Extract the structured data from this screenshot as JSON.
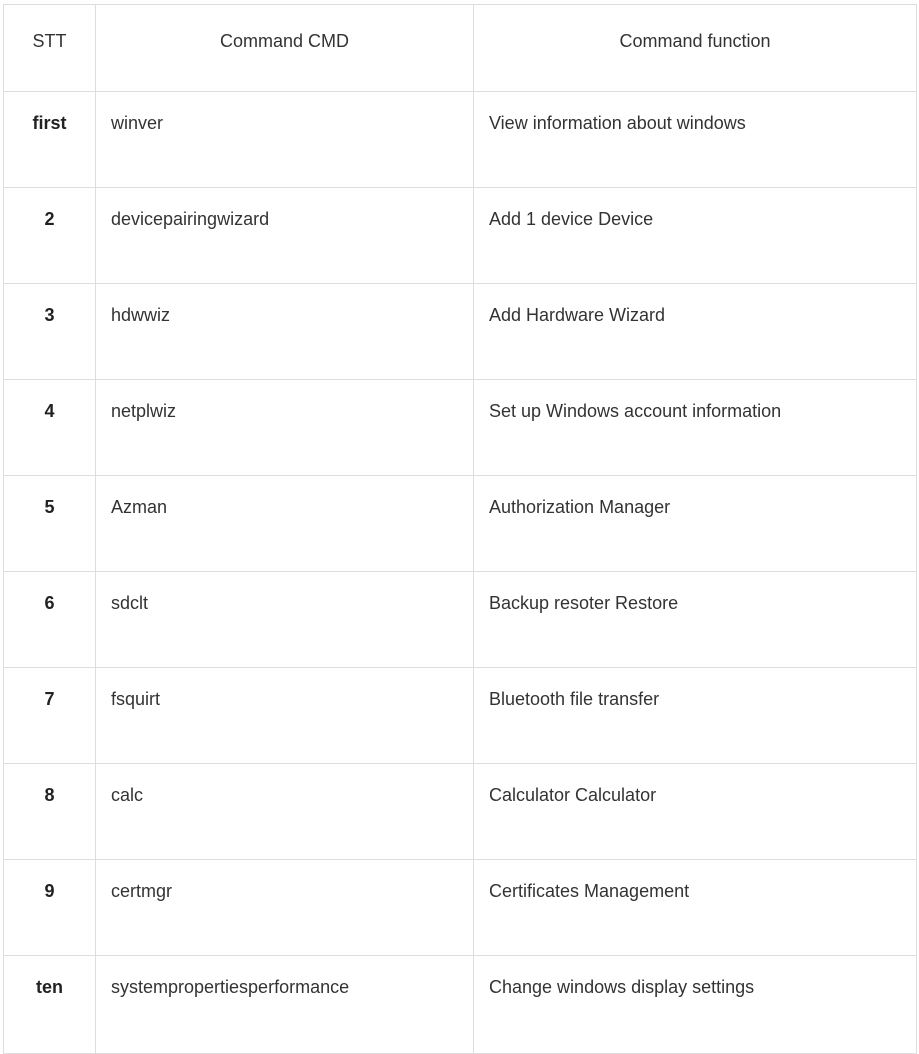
{
  "table": {
    "headers": [
      "STT",
      "Command CMD",
      "Command function"
    ],
    "rows": [
      {
        "stt": "first",
        "command": "winver",
        "function": "View information about windows"
      },
      {
        "stt": "2",
        "command": "devicepairingwizard",
        "function": "Add 1 device Device"
      },
      {
        "stt": "3",
        "command": "hdwwiz",
        "function": "Add Hardware Wizard"
      },
      {
        "stt": "4",
        "command": "netplwiz",
        "function": "Set up Windows account information"
      },
      {
        "stt": "5",
        "command": "Azman",
        "function": "Authorization Manager"
      },
      {
        "stt": "6",
        "command": "sdclt",
        "function": "Backup resoter Restore"
      },
      {
        "stt": "7",
        "command": "fsquirt",
        "function": "Bluetooth file transfer"
      },
      {
        "stt": "8",
        "command": "calc",
        "function": "Calculator Calculator"
      },
      {
        "stt": "9",
        "command": "certmgr",
        "function": "Certificates Management"
      },
      {
        "stt": "ten",
        "command": "systempropertiesperformance",
        "function": "Change windows display settings"
      }
    ]
  }
}
